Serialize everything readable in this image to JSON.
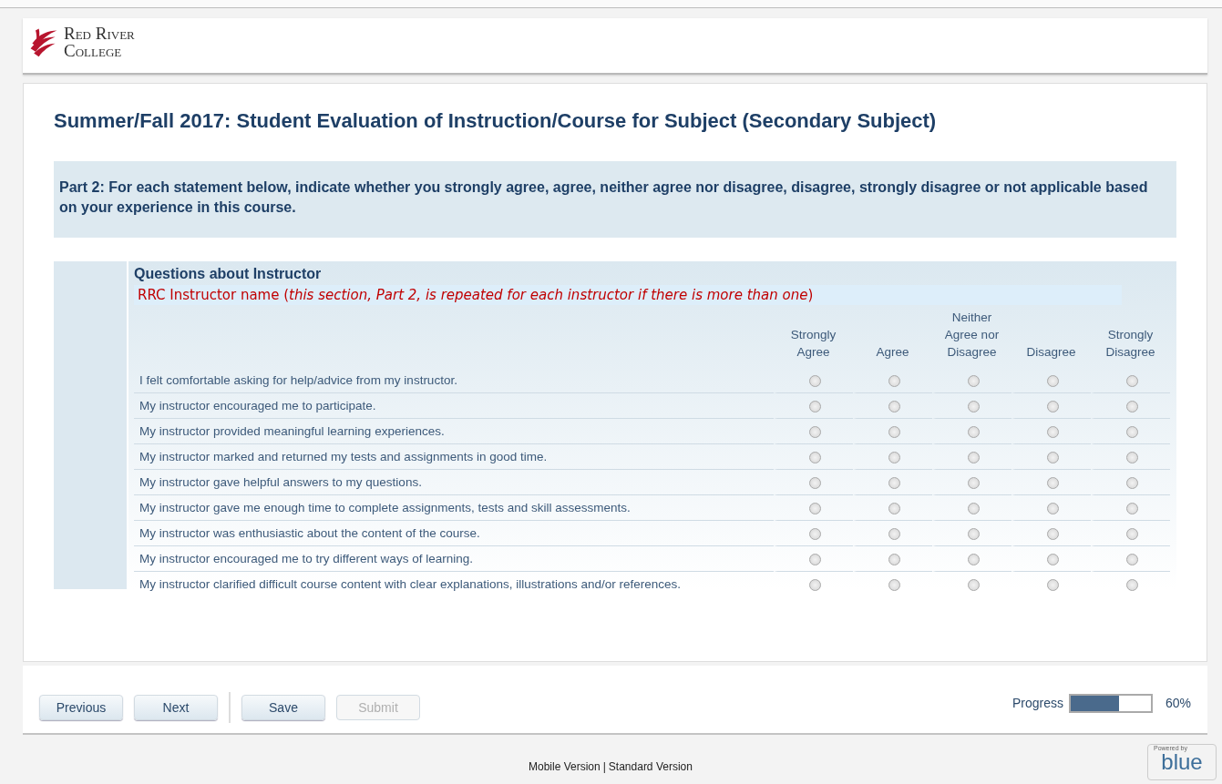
{
  "header": {
    "logo_line1": "Red River",
    "logo_line2": "College"
  },
  "title": "Summer/Fall 2017: Student Evaluation of Instruction/Course for Subject (Secondary Subject)",
  "instructions": "Part 2: For each statement below, indicate whether you strongly agree, agree, neither agree nor disagree, disagree, strongly disagree or not applicable based on your experience in this course.",
  "section": {
    "heading": "Questions about Instructor",
    "note": "RRC Instructor name (*this section, Part 2, is repeated for each instructor if there is more than one*)",
    "columns": [
      "Strongly Agree",
      "Agree",
      "Neither Agree nor Disagree",
      "Disagree",
      "Strongly Disagree"
    ],
    "questions": [
      {
        "text": "I felt comfortable asking for help/advice from my instructor.",
        "choices": [
          {
            "selected": false
          },
          {
            "selected": false
          },
          {
            "selected": false
          },
          {
            "selected": false
          },
          {
            "selected": false
          }
        ]
      },
      {
        "text": "My instructor encouraged me to participate.",
        "choices": [
          {
            "selected": false
          },
          {
            "selected": false
          },
          {
            "selected": false
          },
          {
            "selected": false
          },
          {
            "selected": false
          }
        ]
      },
      {
        "text": "My instructor provided meaningful learning experiences.",
        "choices": [
          {
            "selected": false
          },
          {
            "selected": false
          },
          {
            "selected": false
          },
          {
            "selected": false
          },
          {
            "selected": false
          }
        ]
      },
      {
        "text": "My instructor marked and returned my tests and assignments in good time.",
        "choices": [
          {
            "selected": false
          },
          {
            "selected": false
          },
          {
            "selected": false
          },
          {
            "selected": false
          },
          {
            "selected": false
          }
        ]
      },
      {
        "text": "My instructor gave helpful answers to my questions.",
        "choices": [
          {
            "selected": false
          },
          {
            "selected": false
          },
          {
            "selected": false
          },
          {
            "selected": false
          },
          {
            "selected": false
          }
        ]
      },
      {
        "text": "My instructor gave me enough time to complete assignments, tests and skill assessments.",
        "choices": [
          {
            "selected": false
          },
          {
            "selected": false
          },
          {
            "selected": false
          },
          {
            "selected": false
          },
          {
            "selected": false
          }
        ]
      },
      {
        "text": "My instructor was enthusiastic about the content of the course.",
        "choices": [
          {
            "selected": false
          },
          {
            "selected": false
          },
          {
            "selected": false
          },
          {
            "selected": false
          },
          {
            "selected": false
          }
        ]
      },
      {
        "text": "My instructor encouraged me to try different ways of learning.",
        "choices": [
          {
            "selected": false
          },
          {
            "selected": false
          },
          {
            "selected": false
          },
          {
            "selected": false
          },
          {
            "selected": false
          }
        ]
      },
      {
        "text": "My instructor clarified difficult course content with clear explanations, illustrations and/or references.",
        "choices": [
          {
            "selected": false
          },
          {
            "selected": false
          },
          {
            "selected": false
          },
          {
            "selected": false
          },
          {
            "selected": false
          }
        ]
      }
    ]
  },
  "nav_buttons": [
    {
      "label": "Previous",
      "disabled": false
    },
    {
      "label": "Next",
      "disabled": false
    }
  ],
  "action_buttons": [
    {
      "label": "Save",
      "disabled": false
    },
    {
      "label": "Submit",
      "disabled": true
    }
  ],
  "progress": {
    "label": "Progress",
    "level": 0.6,
    "reading": "60%"
  },
  "footer": {
    "links": [
      "Mobile Version",
      "Standard Version"
    ],
    "separator": "|",
    "powered_by": "Powered by",
    "brand": "blue"
  }
}
